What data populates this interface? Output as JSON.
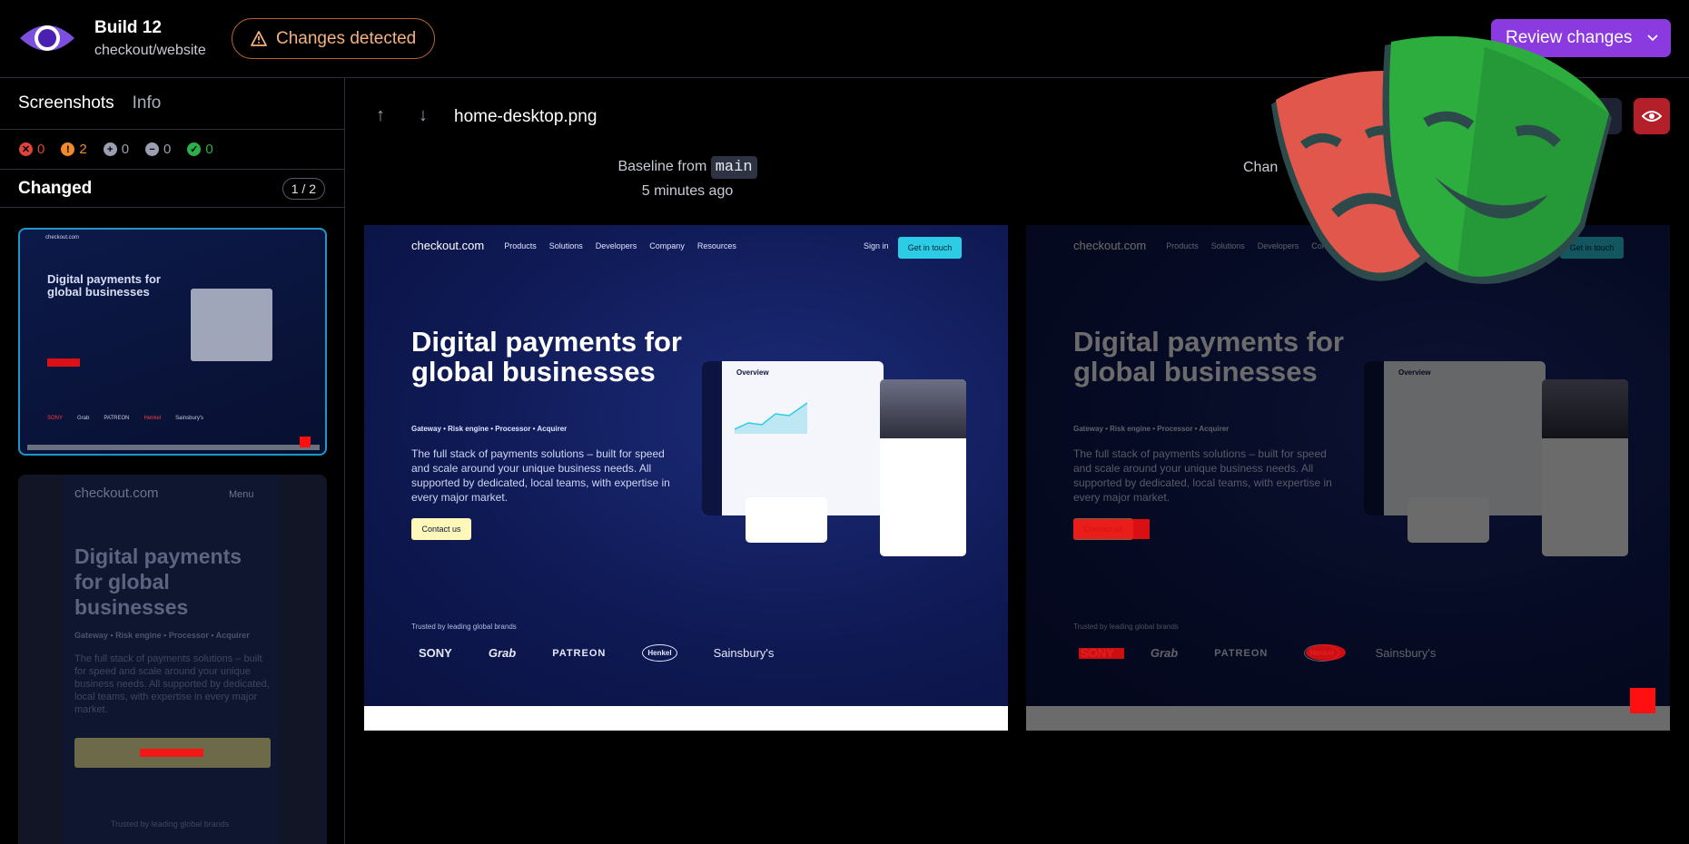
{
  "header": {
    "build_title": "Build 12",
    "repo": "checkout/website",
    "status_badge": "Changes detected",
    "review_button": "Review changes"
  },
  "sidebar": {
    "tabs": [
      "Screenshots",
      "Info"
    ],
    "counts": {
      "errors": "0",
      "warnings": "2",
      "added": "0",
      "removed": "0",
      "unchanged": "0"
    },
    "group_label": "Changed",
    "pager": "1 / 2"
  },
  "toolbar": {
    "filename": "home-desktop.png"
  },
  "baseline": {
    "caption_prefix": "Baseline from",
    "branch": "main",
    "time": "5 minutes ago"
  },
  "changes": {
    "caption_prefix": "Chan"
  },
  "site": {
    "brand": "checkout.com",
    "nav": [
      "Products",
      "Solutions",
      "Developers",
      "Company",
      "Resources"
    ],
    "sign_in": "Sign in",
    "get_in_touch": "Get in touch",
    "hero": "Digital payments for global businesses",
    "tags": "Gateway  •  Risk engine  •  Processor  •  Acquirer",
    "description": "The full stack of payments solutions – built for speed and scale around your unique business needs. All supported by dedicated, local teams, with expertise in every major market.",
    "contact": "Contact us",
    "trusted": "Trusted by leading global brands",
    "brands": [
      "SONY",
      "Grab",
      "PATREON",
      "Henkel",
      "Sainsbury's"
    ],
    "overview": "Overview",
    "mobile_menu": "Menu"
  },
  "colors": {
    "accent": "#8b3ae0",
    "warning": "#f5b27c",
    "selected_border": "#1f96c9",
    "diff_red": "#ff1010"
  }
}
